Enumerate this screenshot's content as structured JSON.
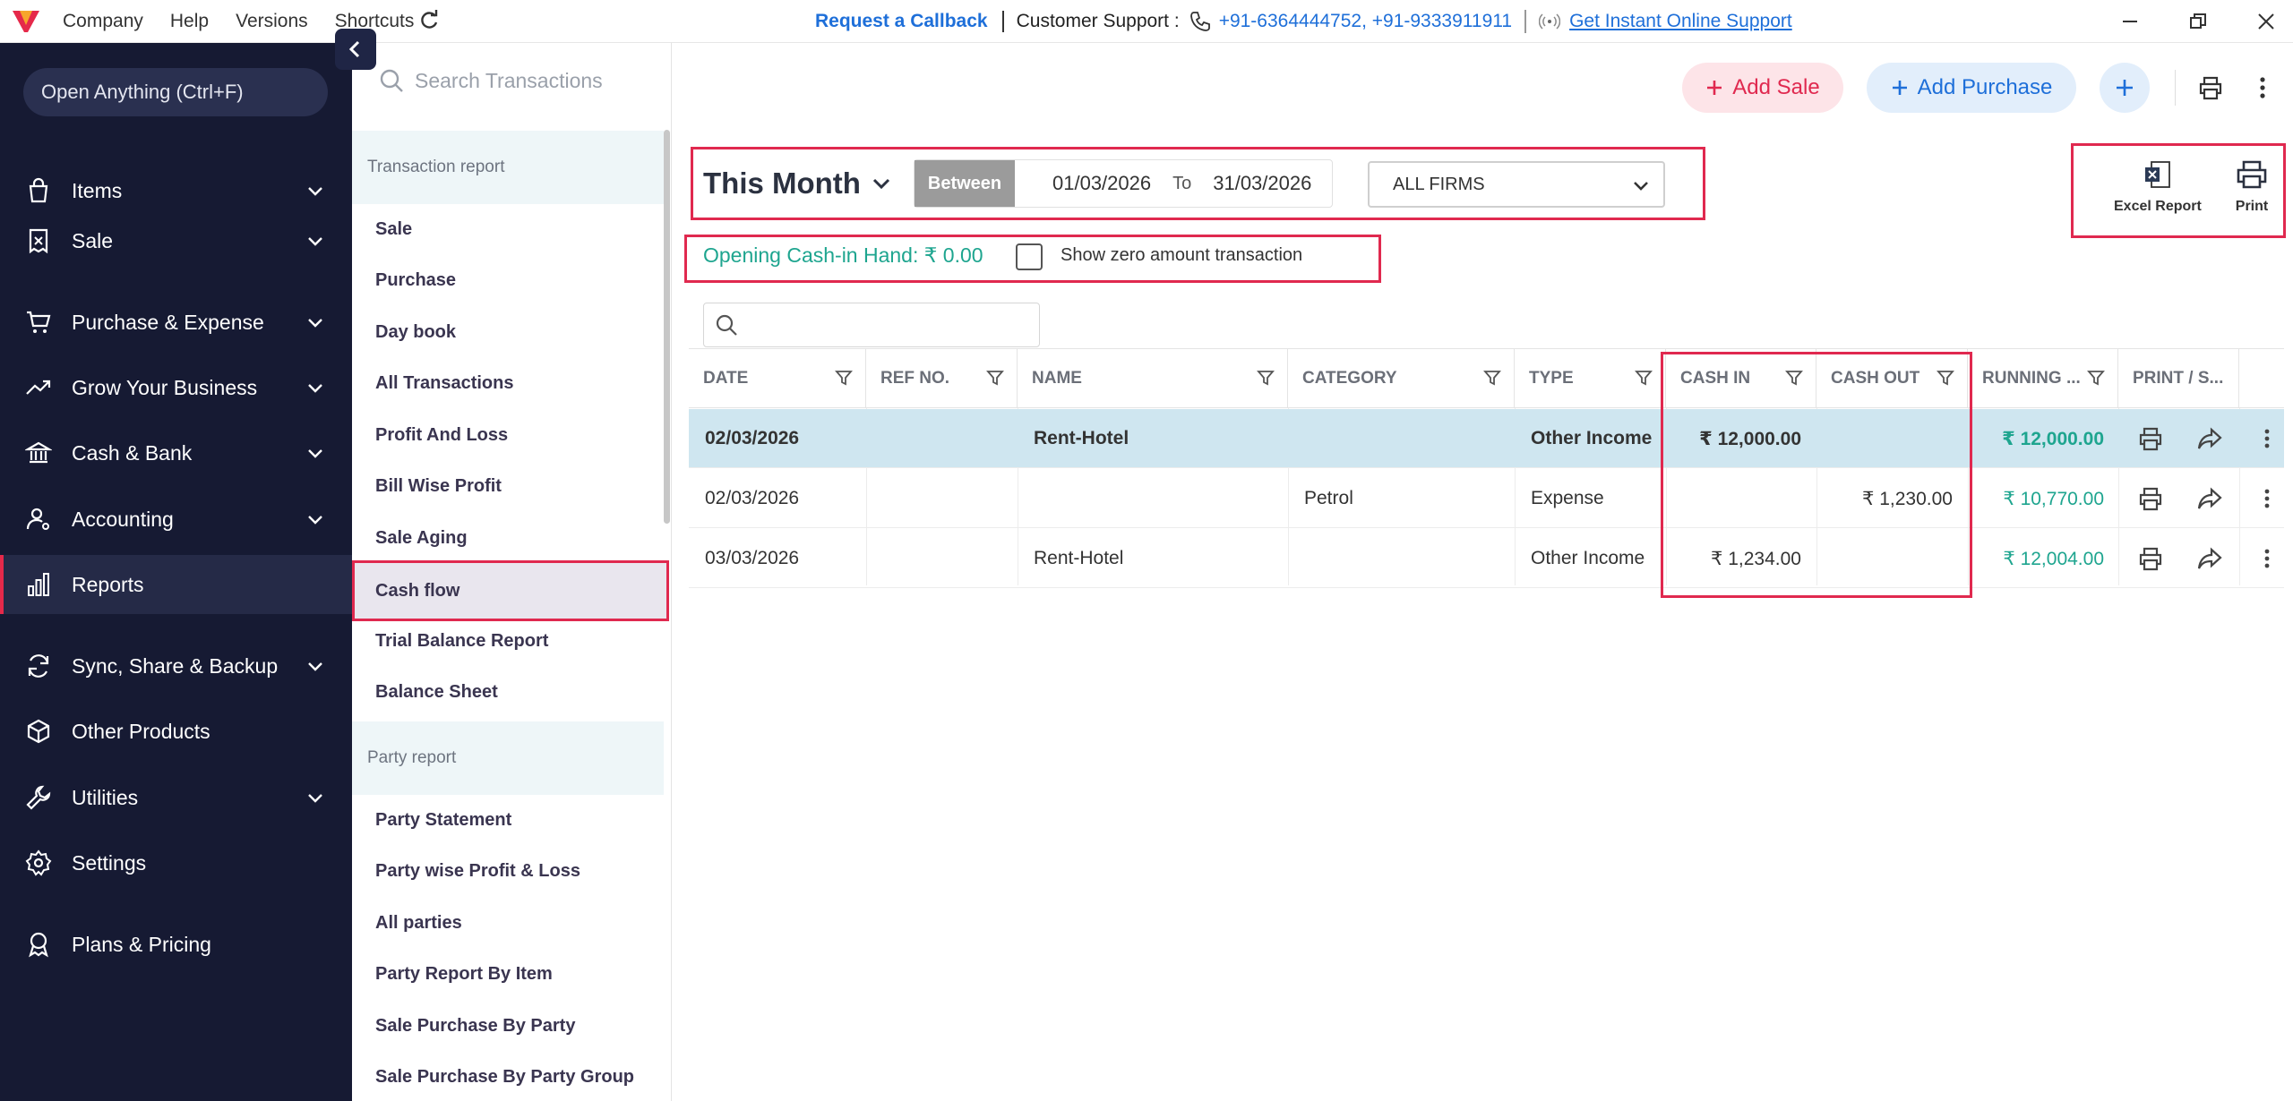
{
  "topbar": {
    "menu": [
      "Company",
      "Help",
      "Versions",
      "Shortcuts"
    ],
    "request_callback": "Request a Callback",
    "customer_support_label": "Customer Support :",
    "phones": "+91-6364444752, +91-9333911911",
    "instant_support": "Get Instant Online Support"
  },
  "sidebar": {
    "open_anything": "Open Anything (Ctrl+F)",
    "items": [
      {
        "label": "Items",
        "icon": "bag-icon",
        "chevron": true
      },
      {
        "label": "Sale",
        "icon": "receipt-icon",
        "chevron": true
      },
      {
        "label": "Purchase & Expense",
        "icon": "cart-icon",
        "chevron": true
      },
      {
        "label": "Grow Your Business",
        "icon": "trend-icon",
        "chevron": true
      },
      {
        "label": "Cash & Bank",
        "icon": "bank-icon",
        "chevron": true
      },
      {
        "label": "Accounting",
        "icon": "user-cog-icon",
        "chevron": true
      },
      {
        "label": "Reports",
        "icon": "bar-chart-icon",
        "chevron": false
      },
      {
        "label": "Sync, Share & Backup",
        "icon": "sync-icon",
        "chevron": true
      },
      {
        "label": "Other Products",
        "icon": "box-icon",
        "chevron": false
      },
      {
        "label": "Utilities",
        "icon": "wrench-icon",
        "chevron": true
      },
      {
        "label": "Settings",
        "icon": "gear-icon",
        "chevron": false
      },
      {
        "label": "Plans & Pricing",
        "icon": "badge-icon",
        "chevron": false
      }
    ]
  },
  "subpanel": {
    "search_placeholder": "Search Transactions",
    "transaction_header": "Transaction report",
    "transaction_items": [
      "Sale",
      "Purchase",
      "Day book",
      "All Transactions",
      "Profit And Loss",
      "Bill Wise Profit",
      "Sale Aging",
      "Cash flow",
      "Trial Balance Report",
      "Balance Sheet"
    ],
    "party_header": "Party report",
    "party_items": [
      "Party Statement",
      "Party wise Profit & Loss",
      "All parties",
      "Party Report By Item",
      "Sale Purchase By Party",
      "Sale Purchase By Party Group"
    ]
  },
  "header": {
    "add_sale": "Add Sale",
    "add_purchase": "Add Purchase"
  },
  "filters": {
    "period": "This Month",
    "between": "Between",
    "from": "01/03/2026",
    "to_label": "To",
    "to": "31/03/2026",
    "firm": "ALL FIRMS",
    "excel": "Excel Report",
    "print": "Print",
    "opening_cash": "Opening Cash-in Hand: ₹ 0.00",
    "show_zero": "Show zero amount transaction"
  },
  "table": {
    "columns": [
      "DATE",
      "REF NO.",
      "NAME",
      "CATEGORY",
      "TYPE",
      "CASH IN",
      "CASH OUT",
      "RUNNING ...",
      "PRINT / S..."
    ],
    "rows": [
      {
        "date": "02/03/2026",
        "ref": "",
        "name": "Rent-Hotel",
        "category": "",
        "type": "Other Income",
        "cash_in": "₹ 12,000.00",
        "cash_out": "",
        "running": "₹ 12,000.00"
      },
      {
        "date": "02/03/2026",
        "ref": "",
        "name": "",
        "category": "Petrol",
        "type": "Expense",
        "cash_in": "",
        "cash_out": "₹ 1,230.00",
        "running": "₹ 10,770.00"
      },
      {
        "date": "03/03/2026",
        "ref": "",
        "name": "Rent-Hotel",
        "category": "",
        "type": "Other Income",
        "cash_in": "₹ 1,234.00",
        "cash_out": "",
        "running": "₹ 12,004.00"
      }
    ]
  },
  "colors": {
    "sidebar_bg": "#161a33",
    "accent_red": "#e0294f",
    "accent_blue": "#1e6fd9",
    "accent_green": "#1ea58f"
  }
}
